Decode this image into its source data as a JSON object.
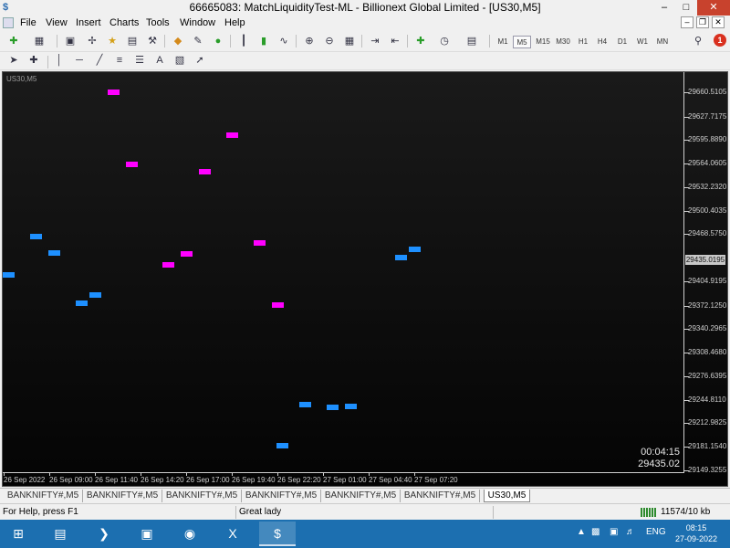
{
  "window": {
    "title": "66665083: MatchLiquidityTest-ML - Billionext Global Limited - [US30,M5]"
  },
  "menu": [
    "File",
    "View",
    "Insert",
    "Charts",
    "Tools",
    "Window",
    "Help"
  ],
  "toolbar": {
    "timeframes": [
      "M1",
      "M5",
      "M15",
      "M30",
      "H1",
      "H4",
      "D1",
      "W1",
      "MN"
    ],
    "active_timeframe": "M5",
    "notification_count": "1"
  },
  "chart": {
    "label": "US30,M5",
    "price_levels": [
      "29660.5105",
      "29627.7175",
      "29595.8890",
      "29564.0605",
      "29532.2320",
      "29500.4035",
      "29468.5750",
      "29404.9195",
      "29372.1250",
      "29340.2965",
      "29308.4680",
      "29276.6395",
      "29244.8110",
      "29212.9825",
      "29181.1540",
      "29149.3255"
    ],
    "current_price": "29435.0195",
    "time_labels": [
      "26 Sep 2022",
      "26 Sep 09:00",
      "26 Sep 11:40",
      "26 Sep 14:20",
      "26 Sep 17:00",
      "26 Sep 19:40",
      "26 Sep 22:20",
      "27 Sep 01:00",
      "27 Sep 04:40",
      "27 Sep 07:20"
    ],
    "timer": "00:04:15",
    "bid": "29435.02",
    "marker_colors": {
      "up": "#ff00ff",
      "down": "#1e90ff"
    }
  },
  "chart_data": {
    "type": "scatter",
    "title": "",
    "xlabel": "",
    "ylabel": "",
    "ylim": [
      29149.3255,
      29676
    ],
    "x_labels": [
      "26 Sep 2022",
      "26 Sep 09:00",
      "26 Sep 11:40",
      "26 Sep 14:20",
      "26 Sep 17:00",
      "26 Sep 19:40",
      "26 Sep 22:20",
      "27 Sep 01:00",
      "27 Sep 04:40",
      "27 Sep 07:20"
    ],
    "series": [
      {
        "points": [
          {
            "x": 2.4,
            "y": 29660.5
          },
          {
            "x": 2.8,
            "y": 29563.5
          },
          {
            "x": 3.6,
            "y": 29427.0
          },
          {
            "x": 4.0,
            "y": 29442.0
          },
          {
            "x": 4.4,
            "y": 29553.0
          },
          {
            "x": 5.0,
            "y": 29603.0
          },
          {
            "x": 5.6,
            "y": 29456.5
          },
          {
            "x": 6.0,
            "y": 29373.0
          }
        ]
      },
      {
        "points": [
          {
            "x": 0.1,
            "y": 29413.0
          },
          {
            "x": 0.7,
            "y": 29466.0
          },
          {
            "x": 1.1,
            "y": 29443.5
          },
          {
            "x": 1.7,
            "y": 29375.0
          },
          {
            "x": 2.0,
            "y": 29387.0
          },
          {
            "x": 6.1,
            "y": 29183.0
          },
          {
            "x": 6.6,
            "y": 29238.5
          },
          {
            "x": 7.2,
            "y": 29235.0
          },
          {
            "x": 7.6,
            "y": 29236.0
          },
          {
            "x": 8.7,
            "y": 29436.5
          },
          {
            "x": 9.0,
            "y": 29448.5
          }
        ]
      }
    ]
  },
  "tabs": [
    "BANKNIFTY#,M5",
    "BANKNIFTY#,M5",
    "BANKNIFTY#,M5",
    "BANKNIFTY#,M5",
    "BANKNIFTY#,M5",
    "BANKNIFTY#,M5",
    "US30,M5"
  ],
  "status": {
    "help": "For Help, press F1",
    "profile": "Great lady",
    "traffic": "11574/10 kb"
  },
  "taskbar": {
    "lang": "ENG",
    "time": "08:15",
    "date": "27-09-2022"
  }
}
